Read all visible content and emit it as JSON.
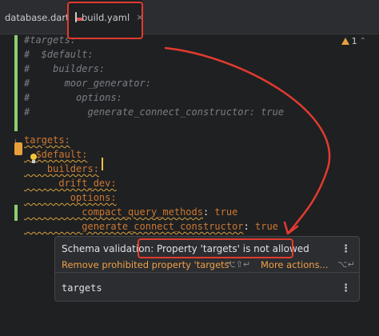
{
  "tabs": [
    {
      "label": "database.dart",
      "close": ""
    },
    {
      "label": "build.yaml",
      "close": "×"
    }
  ],
  "warnings": {
    "count": "1",
    "arrow": "⌃"
  },
  "code": {
    "c1": "#targets:",
    "c2": "#  $default:",
    "c3": "#    builders:",
    "c4": "#      moor_generator:",
    "c5": "#        options:",
    "c6": "#          generate_connect_constructor: true",
    "l1": "targets:",
    "l2": "  $default:",
    "l3": "    builders:",
    "l4": "      drift_dev:",
    "l5": "        options:",
    "l6k": "          compact_query_methods",
    "l6v": " true",
    "l7k": "          generate_connect_constructor",
    "l7v": " true",
    "colon": ":"
  },
  "popup": {
    "title": "Schema validation: Property 'targets' is not allowed",
    "fix": "Remove prohibited property 'targets'",
    "fix_shortcut": "⌥⇧↵",
    "more": "More actions...",
    "more_shortcut": "⌥↵",
    "menu": "⋮",
    "target": "targets"
  },
  "colors": {
    "annotation": "#e23b2f",
    "change": "#8fce6f",
    "warning": "#e8a13a"
  }
}
